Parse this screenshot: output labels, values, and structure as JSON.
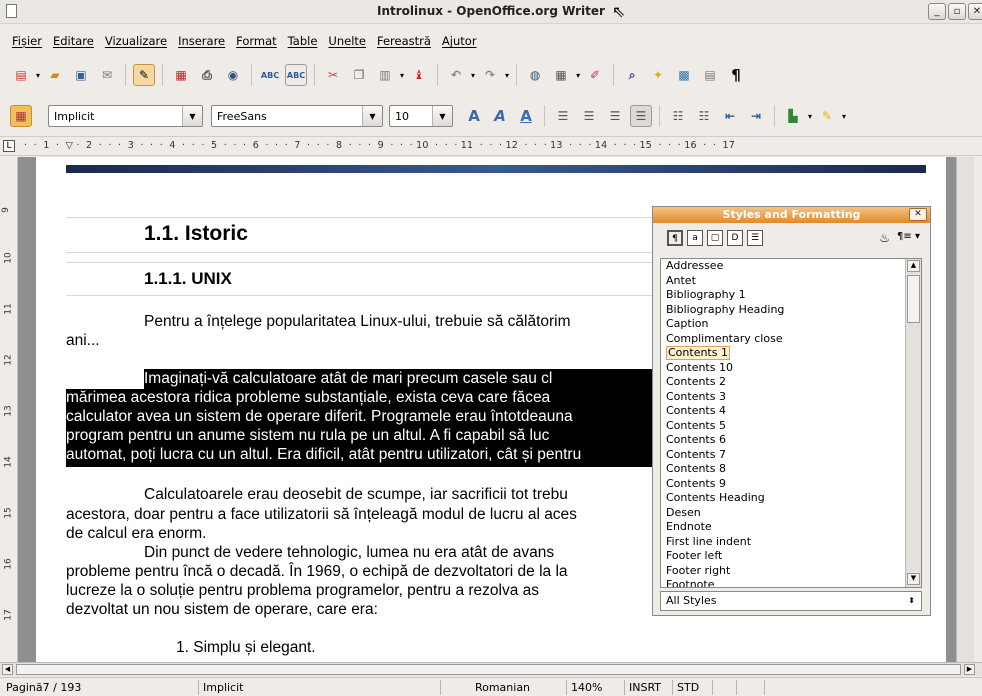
{
  "window": {
    "title": "Introlinux - OpenOffice.org Writer"
  },
  "menu": [
    "Fișier",
    "Editare",
    "Vizualizare",
    "Inserare",
    "Format",
    "Table",
    "Unelte",
    "Fereastră",
    "Ajutor"
  ],
  "formatting": {
    "style": "Implicit",
    "font": "FreeSans",
    "size": "10"
  },
  "ruler_text": "·  ·  1  ·  ▽ ·  2  ·  ·  ·  3  ·  ·  ·  4  ·  ·  ·  5  ·  ·  ·  6  ·  ·  ·  7  ·  ·  ·  8  ·  ·  ·  9  ·  ·  · 10  ·  ·  · 11  ·  ·  · 12  ·  ·  · 13  ·  ·  · 14  ·  ·  · 15  ·  ·  · 16  ·  ·  17",
  "vruler": [
    "9",
    "10",
    "11",
    "12",
    "13",
    "14",
    "15",
    "16",
    "17"
  ],
  "document": {
    "heading1": "1.1. Istoric",
    "heading2": "1.1.1. UNIX",
    "p1_l1": "Pentru a înțelege popularitatea Linux-ului, trebuie să călătorim",
    "p1_l2": "ani...",
    "sel_l1": "Imaginați-vă calculatoare atât de mari precum casele sau cl",
    "sel_l2": "mărimea acestora ridica probleme substanțiale, exista ceva care făcea",
    "sel_l3": "calculator avea un sistem de operare diferit. Programele erau întotdeauna",
    "sel_l4": "program pentru un anume sistem nu rula pe un altul. A fi capabil să luc",
    "sel_l5": "automat, poți lucra cu un altul. Era dificil, atât pentru utilizatori, cât și pentru",
    "p3_l1": "Calculatoarele erau deosebit de scumpe, iar sacrificii tot trebu",
    "p3_l2": "acestora, doar pentru a face utilizatorii să înțeleagă modul de lucru al aces",
    "p3_l3": "de calcul era enorm.",
    "p4_l1": "Din punct de vedere tehnologic, lumea nu era atât de avans",
    "p4_l2": "probleme pentru încă o decadă. În 1969, o echipă de dezvoltatori de la la",
    "p4_l3": "lucreze la o soluție pentru problema programelor, pentru a rezolva as",
    "p4_l4": "dezvoltat un nou sistem de operare, care era:",
    "list1": "1.   Simplu și elegant."
  },
  "styles_panel": {
    "title": "Styles and Formatting",
    "items": [
      "Addressee",
      "Antet",
      "Bibliography 1",
      "Bibliography Heading",
      "Caption",
      "Complimentary close",
      "Contents 1",
      "Contents 10",
      "Contents 2",
      "Contents 3",
      "Contents 4",
      "Contents 5",
      "Contents 6",
      "Contents 7",
      "Contents 8",
      "Contents 9",
      "Contents Heading",
      "Desen",
      "Endnote",
      "First line indent",
      "Footer left",
      "Footer right",
      "Footnote"
    ],
    "selected": "Contents 1",
    "filter": "All Styles"
  },
  "status": {
    "page": "Pagină7 / 193",
    "style": "Implicit",
    "language": "Romanian",
    "zoom": "140%",
    "insert": "INSRT",
    "selection": "STD"
  }
}
